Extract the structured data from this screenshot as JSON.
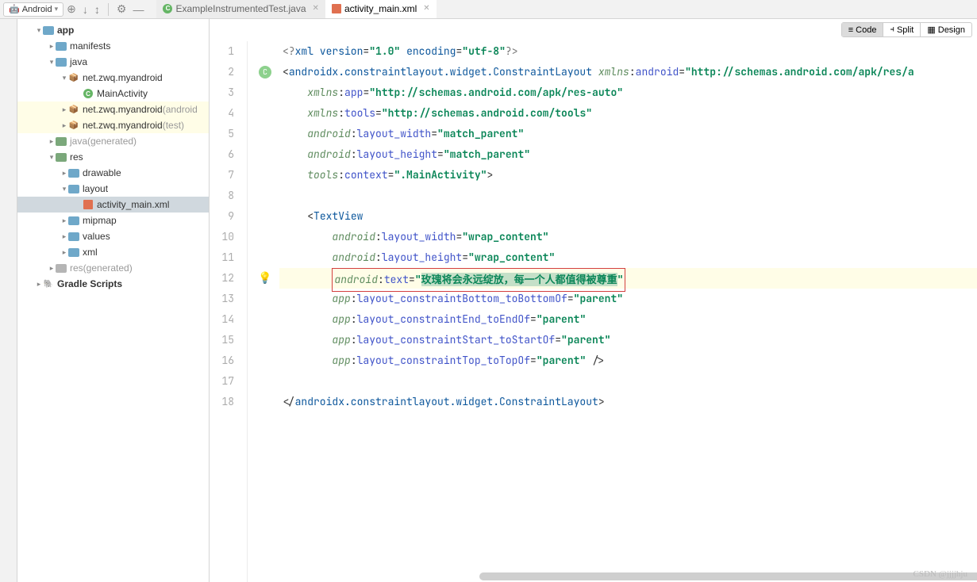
{
  "topbar": {
    "module": "Android",
    "module_icon": "🤖"
  },
  "tabs": [
    {
      "label": "ExampleInstrumentedTest.java",
      "icon": "c",
      "active": false
    },
    {
      "label": "activity_main.xml",
      "icon": "xml",
      "active": true
    }
  ],
  "viewModes": [
    {
      "label": "Code",
      "icon": "≡",
      "active": true
    },
    {
      "label": "Split",
      "icon": "⫞",
      "active": false
    },
    {
      "label": "Design",
      "icon": "▦",
      "active": false
    }
  ],
  "warning": {
    "count": "1"
  },
  "project": {
    "root": "app",
    "items": [
      {
        "pad": 22,
        "arrow": "down",
        "icon": "folder",
        "label": "app",
        "bold": true
      },
      {
        "pad": 38,
        "arrow": "right",
        "icon": "folder",
        "label": "manifests"
      },
      {
        "pad": 38,
        "arrow": "down",
        "icon": "folder",
        "label": "java"
      },
      {
        "pad": 54,
        "arrow": "down",
        "icon": "pkg",
        "label": "net.zwq.myandroid"
      },
      {
        "pad": 72,
        "arrow": "",
        "icon": "class",
        "label": "MainActivity"
      },
      {
        "pad": 54,
        "arrow": "right",
        "icon": "pkg",
        "label": "net.zwq.myandroid",
        "suffix": " (android",
        "hl": true
      },
      {
        "pad": 54,
        "arrow": "right",
        "icon": "pkg",
        "label": "net.zwq.myandroid",
        "suffix": " (test)",
        "hl": true
      },
      {
        "pad": 38,
        "arrow": "right",
        "icon": "folder-green",
        "label": "java",
        "suffix": " (generated)",
        "dimLabel": true
      },
      {
        "pad": 38,
        "arrow": "down",
        "icon": "folder-green",
        "label": "res"
      },
      {
        "pad": 54,
        "arrow": "right",
        "icon": "folder",
        "label": "drawable"
      },
      {
        "pad": 54,
        "arrow": "down",
        "icon": "folder",
        "label": "layout"
      },
      {
        "pad": 72,
        "arrow": "",
        "icon": "xml",
        "label": "activity_main.xml",
        "sel": true
      },
      {
        "pad": 54,
        "arrow": "right",
        "icon": "folder",
        "label": "mipmap"
      },
      {
        "pad": 54,
        "arrow": "right",
        "icon": "folder",
        "label": "values"
      },
      {
        "pad": 54,
        "arrow": "right",
        "icon": "folder",
        "label": "xml"
      },
      {
        "pad": 38,
        "arrow": "right",
        "icon": "folder-grey",
        "label": "res",
        "suffix": " (generated)",
        "dimLabel": true
      },
      {
        "pad": 22,
        "arrow": "right",
        "icon": "gradle",
        "label": "Gradle Scripts",
        "bold": true
      }
    ]
  },
  "code": {
    "lines": 18,
    "xml_decl": {
      "version": "1.0",
      "encoding": "utf-8"
    },
    "root_tag": "androidx.constraintlayout.widget.ConstraintLayout",
    "ns_android": "android",
    "ns_xmlns": "xmlns",
    "ns_app": "app",
    "ns_tools": "tools",
    "attrs": {
      "xmlns_android": "http://schemas.android.com/apk/res/a",
      "xmlns_app": "http://schemas.android.com/apk/res-auto",
      "xmlns_tools": "http://schemas.android.com/tools",
      "layout_width": "match_parent",
      "layout_height": "match_parent",
      "tools_context": ".MainActivity"
    },
    "textview": {
      "tag": "TextView",
      "layout_width": "wrap_content",
      "layout_height": "wrap_content",
      "text": "玫瑰将会永远绽放，每一个人都值得被尊重",
      "constraint_bottom": "parent",
      "constraint_end": "parent",
      "constraint_start": "parent",
      "constraint_top": "parent"
    },
    "attr_names": {
      "layout_width": "layout_width",
      "layout_height": "layout_height",
      "context": "context",
      "text": "text",
      "cb": "layout_constraintBottom_toBottomOf",
      "ce": "layout_constraintEnd_toEndOf",
      "cs": "layout_constraintStart_toStartOf",
      "ct": "layout_constraintTop_toTopOf"
    }
  },
  "watermark": "CSDN @jjjjhju"
}
